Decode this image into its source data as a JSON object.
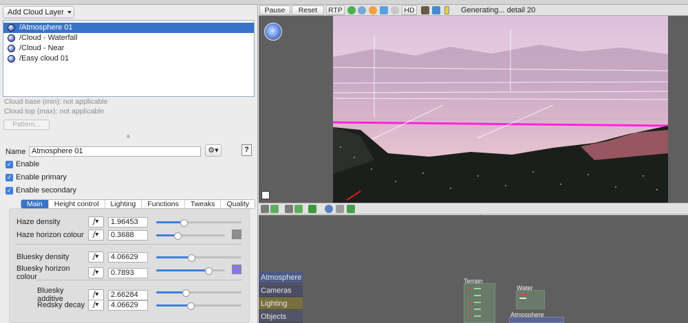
{
  "left_panel": {
    "add_layer_label": "Add Cloud Layer",
    "layers": [
      {
        "label": "/Atmosphere 01",
        "selected": true
      },
      {
        "label": "/Cloud - Waterfall",
        "selected": false
      },
      {
        "label": "/Cloud - Near",
        "selected": false
      },
      {
        "label": "/Easy cloud 01",
        "selected": false
      }
    ],
    "cloud_base": "Cloud base (min): not applicable",
    "cloud_top": "Cloud top (max): not applicable",
    "pattern_label": "Pattern...",
    "name_label": "Name",
    "name_value": "Atmosphere 01",
    "help_label": "?",
    "checkboxes": [
      {
        "label": "Enable",
        "checked": true
      },
      {
        "label": "Enable primary",
        "checked": true
      },
      {
        "label": "Enable secondary",
        "checked": true
      }
    ],
    "tabs": [
      {
        "label": "Main",
        "active": true
      },
      {
        "label": "Height control",
        "active": false
      },
      {
        "label": "Lighting",
        "active": false
      },
      {
        "label": "Functions",
        "active": false
      },
      {
        "label": "Tweaks",
        "active": false
      },
      {
        "label": "Quality",
        "active": false
      }
    ],
    "params": [
      {
        "label": "Haze density",
        "value": "1.96453",
        "slider_fraction": 0.32
      },
      {
        "label": "Haze horizon colour",
        "value": "0.3688",
        "slider_fraction": 0.31,
        "swatch": "#8f8f8f"
      },
      {
        "label": "Bluesky density",
        "value": "4.06629",
        "slider_fraction": 0.41
      },
      {
        "label": "Bluesky horizon colour",
        "value": "0.7893",
        "slider_fraction": 0.76,
        "swatch": "#8a78e6"
      },
      {
        "label": "Bluesky additive",
        "value": "2.66284",
        "slider_fraction": 0.35
      },
      {
        "label": "Redsky decay",
        "value": "4.06629",
        "slider_fraction": 0.4
      }
    ]
  },
  "toolbar": {
    "pause_label": "Pause",
    "reset_label": "Reset",
    "rtp_label": "RTP",
    "hd_label": "HD",
    "status": "Generating... detail 20"
  },
  "icons": [
    "globe-icon",
    "sphere-icon",
    "sun-icon",
    "camera-icon",
    "gear-icon",
    "brush-icon",
    "wand-icon",
    "battery-icon",
    "eye-icon",
    "crop-icon",
    "plant-icon"
  ],
  "node_panel": {
    "categories": [
      {
        "label": "Atmosphere",
        "color": "#4c5a86"
      },
      {
        "label": "Cameras",
        "color": "#4d4d66"
      },
      {
        "label": "Lighting",
        "color": "#77703e"
      },
      {
        "label": "Objects",
        "color": "#505466"
      }
    ],
    "nodes": {
      "terrain": "Terrain",
      "water": "Water",
      "atmosphere": "Atmosphere"
    }
  },
  "colors": {
    "selection": "#3873c8",
    "checkbox": "#3f7ee0",
    "render_sky": "#e6c8d8"
  }
}
